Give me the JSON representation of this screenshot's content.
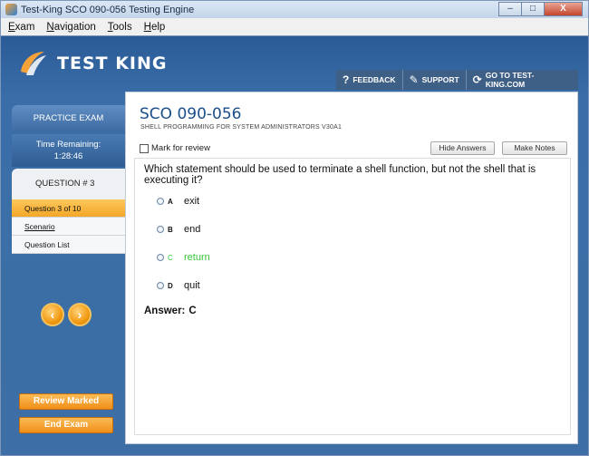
{
  "window": {
    "title": "Test-King SCO 090-056 Testing Engine",
    "minimize": "–",
    "maximize": "□",
    "close": "X"
  },
  "menu": {
    "items": [
      {
        "underline": "E",
        "rest": "xam"
      },
      {
        "underline": "N",
        "rest": "avigation"
      },
      {
        "underline": "T",
        "rest": "ools"
      },
      {
        "underline": "H",
        "rest": "elp"
      }
    ]
  },
  "brand": {
    "name": "TEST KING"
  },
  "topnav": {
    "feedback": "FEEDBACK",
    "support": "SUPPORT",
    "goto": "GO TO TEST-KING.COM"
  },
  "sidebar": {
    "practice": "PRACTICE EXAM",
    "time_label": "Time Remaining:",
    "time_value": "1:28:46",
    "question_tab": "QUESTION # 3",
    "items": [
      "Question 3 of 10",
      "Scenario",
      "Question List"
    ],
    "prev": "‹",
    "next": "›",
    "review_marked": "Review Marked",
    "end_exam": "End Exam"
  },
  "exam": {
    "title": "SCO 090-056",
    "subtitle": "SHELL PROGRAMMING FOR SYSTEM ADMINISTRATORS V30A1",
    "mark_review": "Mark for review",
    "hide_answers": "Hide Answers",
    "make_notes": "Make Notes"
  },
  "question": {
    "text": "Which statement should be used to terminate a shell function, but not the shell that is executing it?",
    "options": [
      {
        "letter": "A",
        "text": "exit"
      },
      {
        "letter": "B",
        "text": "end"
      },
      {
        "letter": "C",
        "text": "return"
      },
      {
        "letter": "D",
        "text": "quit"
      }
    ],
    "answer_label": "Answer:",
    "answer_value": "C"
  },
  "colors": {
    "accent_blue": "#1b4e8a",
    "correct_green": "#35c63b",
    "orange": "#f4a729"
  }
}
